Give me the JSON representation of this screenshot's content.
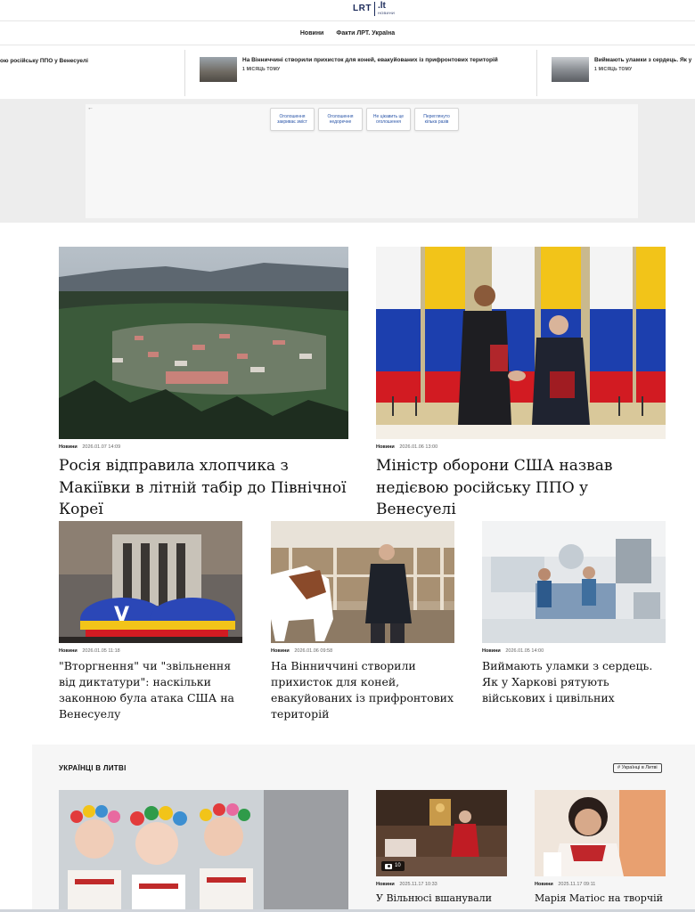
{
  "brand": {
    "logo_main": "LRT",
    "logo_domain": ".lt",
    "logo_sub": "НОВИНИ"
  },
  "nav": {
    "items": [
      "Новини",
      "Факти ЛРТ. Україна"
    ]
  },
  "ticker": [
    {
      "title": "ою російську ППО у Венесуелі",
      "age": ""
    },
    {
      "title": "На Вінниччині створили прихисток для коней, евакуйованих із прифронтових територій",
      "age": "1 МІСЯЦЬ ТОМУ"
    },
    {
      "title": "Виймають уламки з сердець. Як у",
      "age": "1 МІСЯЦЬ ТОМУ"
    }
  ],
  "ad": {
    "back_arrow": "←",
    "buttons": [
      "Оголошення закриває зміст",
      "Оголошення недоречне",
      "Не цікавить це оголошення",
      "Переглянуто кілька разів"
    ]
  },
  "featured": [
    {
      "category": "Новини",
      "date": "2026.01.07 14:09",
      "title": "Росія відправила хлопчика з Макіївки в літній табір до Північної Кореї"
    },
    {
      "category": "Новини",
      "date": "2026.01.06 13:00",
      "title": "Міністр оборони США назвав недієвою російську ППО у Венесуелі"
    }
  ],
  "articles": [
    {
      "category": "Новини",
      "date": "2026.01.05 11:18",
      "title": "\"Вторгнення\" чи \"звільнення від диктатури\": наскільки законною була атака США на Венесуелу"
    },
    {
      "category": "Новини",
      "date": "2026.01.06 09:58",
      "title": "На Вінниччині створили прихисток для коней, евакуйованих із прифронтових територій"
    },
    {
      "category": "Новини",
      "date": "2026.01.05 14:00",
      "title": "Виймають уламки з сердець. Як у Харкові рятують військових і цивільних"
    }
  ],
  "section": {
    "title": "УКРАЇНЦІ В ЛИТВІ",
    "tag": "# Українці в Литві",
    "items": [
      {
        "category": "Новини",
        "date": "2025.11.17 10:33",
        "title": "У Вільнюсі вшанували св.",
        "gallery_count": "10"
      },
      {
        "category": "Новини",
        "date": "2025.11.17 09:11",
        "title": "Марія Матіос на творчій"
      }
    ]
  }
}
